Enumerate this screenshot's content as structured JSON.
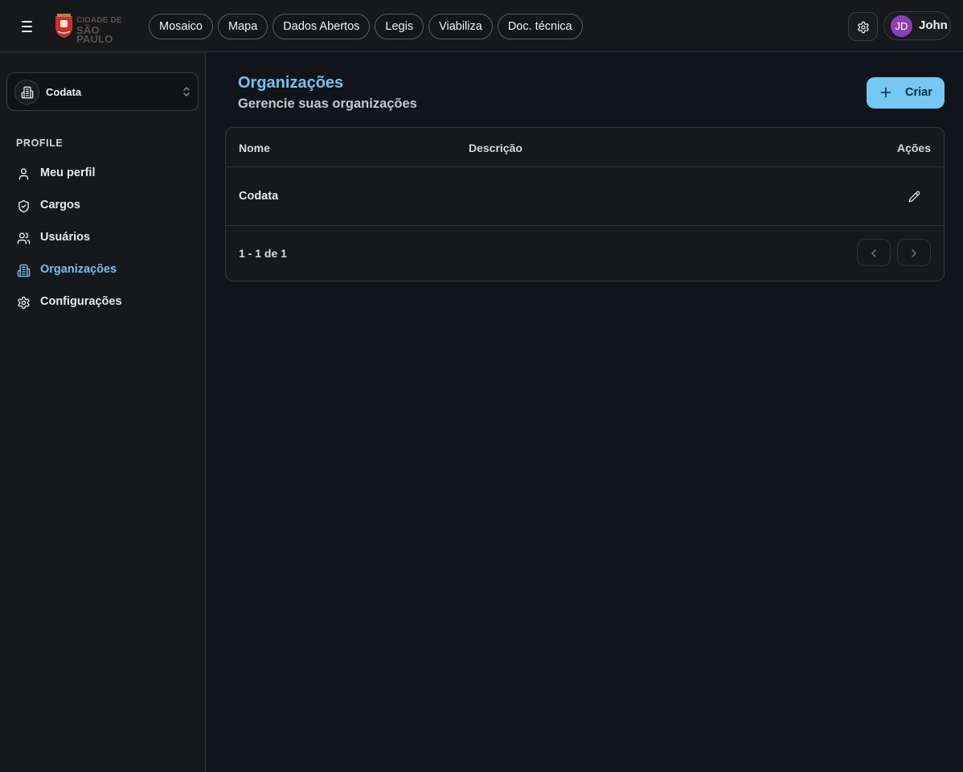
{
  "header": {
    "logo": {
      "line1": "CIDADE DE",
      "line2": "SÃO PAULO"
    },
    "nav": [
      "Mosaico",
      "Mapa",
      "Dados Abertos",
      "Legis",
      "Viabiliza",
      "Doc. técnica"
    ],
    "user": {
      "initials": "JD",
      "name": "John"
    }
  },
  "sidebar": {
    "org_select": {
      "value": "Codata"
    },
    "section_label": "PROFILE",
    "items": [
      {
        "label": "Meu perfil",
        "icon": "user-icon"
      },
      {
        "label": "Cargos",
        "icon": "shield-icon"
      },
      {
        "label": "Usuários",
        "icon": "users-icon"
      },
      {
        "label": "Organizações",
        "icon": "building-icon",
        "active": true
      },
      {
        "label": "Configurações",
        "icon": "gear-icon"
      }
    ]
  },
  "main": {
    "title": "Organizações",
    "subtitle": "Gerencie suas organizações",
    "create_label": "Criar",
    "table": {
      "columns": [
        "Nome",
        "Descrição",
        "Ações"
      ],
      "rows": [
        {
          "name": "Codata",
          "description": ""
        }
      ],
      "pagination": "1 - 1 de 1"
    }
  },
  "colors": {
    "accent": "#74c2ee",
    "background": "#111418",
    "avatar": "#8d3fb5"
  }
}
